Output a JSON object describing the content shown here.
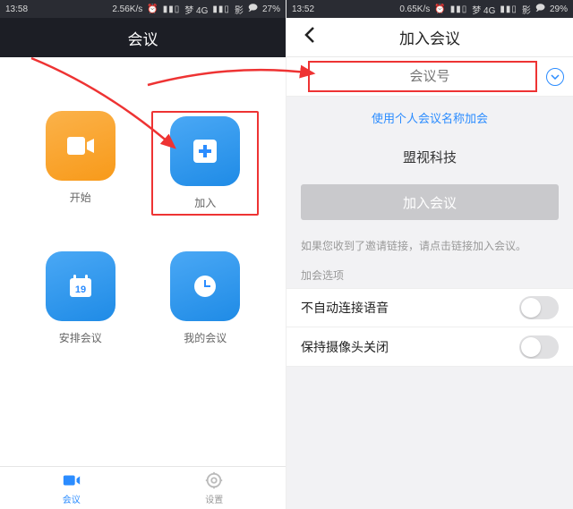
{
  "left": {
    "status": {
      "time": "13:58",
      "speed": "2.56K/s",
      "carrier": "梦 4G",
      "extra": "影",
      "battery": "27%"
    },
    "header_title": "会议",
    "tiles": {
      "start": "开始",
      "join": "加入",
      "schedule": "安排会议",
      "mine": "我的会议",
      "schedule_date": "19"
    },
    "tabs": {
      "meetings": "会议",
      "settings": "设置"
    }
  },
  "right": {
    "status": {
      "time": "13:52",
      "speed": "0.65K/s",
      "carrier": "梦 4G",
      "extra": "影",
      "battery": "29%"
    },
    "header_title": "加入会议",
    "input_placeholder": "会议号",
    "use_personal_link": "使用个人会议名称加会",
    "display_name": "盟视科技",
    "join_button": "加入会议",
    "invite_hint": "如果您收到了邀请链接，请点击链接加入会议。",
    "options_head": "加会选项",
    "opt_audio": "不自动连接语音",
    "opt_video": "保持摄像头关闭"
  }
}
